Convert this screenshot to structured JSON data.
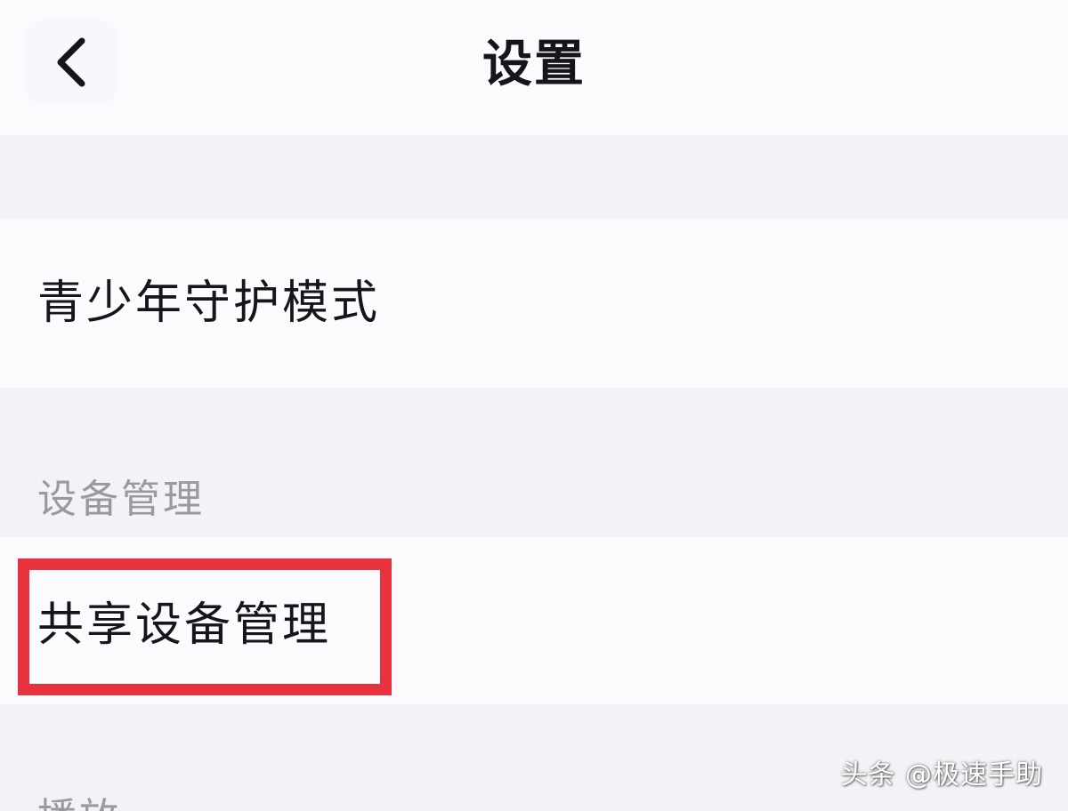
{
  "header": {
    "title": "设置",
    "back_icon": "chevron-left-icon"
  },
  "rows": [
    {
      "label": "青少年守护模式"
    },
    {
      "label": "共享设备管理"
    }
  ],
  "sections": {
    "device_management": "设备管理",
    "playback": "播放"
  },
  "watermark": "头条 @极速手助",
  "colors": {
    "background": "#f3f2f6",
    "row_background": "#fbfafd",
    "text": "#16161a",
    "section_text": "#9a99a2",
    "highlight": "#e8333e"
  }
}
